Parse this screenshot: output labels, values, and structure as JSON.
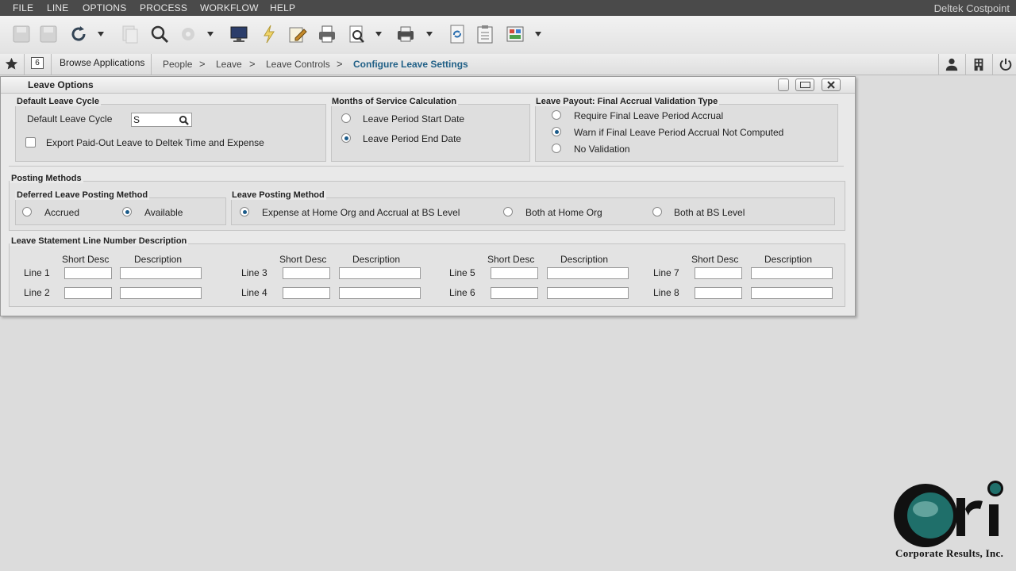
{
  "menu": {
    "items": [
      "FILE",
      "LINE",
      "OPTIONS",
      "PROCESS",
      "WORKFLOW",
      "HELP"
    ],
    "brand": "Deltek Costpoint"
  },
  "nav": {
    "badge": "6",
    "browse": "Browse Applications",
    "crumbs": [
      "People",
      "Leave",
      "Leave Controls"
    ],
    "separator": ">",
    "current": "Configure Leave Settings"
  },
  "window": {
    "title": "Leave Options",
    "default_cycle": {
      "legend": "Default Leave Cycle",
      "field_label": "Default Leave Cycle",
      "field_value": "S",
      "checkbox_label": "Export Paid-Out Leave to Deltek Time and Expense"
    },
    "months_service": {
      "legend": "Months of Service Calculation",
      "options": [
        "Leave Period Start Date",
        "Leave Period End Date"
      ],
      "selected": 1
    },
    "payout": {
      "legend": "Leave Payout: Final Accrual Validation Type",
      "options": [
        "Require Final Leave Period Accrual",
        "Warn if Final Leave Period Accrual Not Computed",
        "No Validation"
      ],
      "selected": 1
    },
    "posting": {
      "legend": "Posting Methods",
      "deferred": {
        "legend": "Deferred Leave Posting Method",
        "options": [
          "Accrued",
          "Available"
        ],
        "selected": 1
      },
      "leave_posting": {
        "legend": "Leave Posting Method",
        "options": [
          "Expense at Home Org and Accrual at BS Level",
          "Both at Home Org",
          "Both at BS Level"
        ],
        "selected": 0
      }
    },
    "statement": {
      "legend": "Leave Statement Line Number Description",
      "short_desc": "Short Desc",
      "description": "Description",
      "lines": [
        "Line 1",
        "Line 2",
        "Line 3",
        "Line 4",
        "Line 5",
        "Line 6",
        "Line 7",
        "Line 8"
      ]
    }
  },
  "logo": {
    "text": "cri",
    "caption": "Corporate Results, Inc."
  },
  "colors": {
    "menubar": "#4a4a4a",
    "breadcrumb_active": "#1f5f86",
    "logo_teal": "#1f6f6a"
  }
}
